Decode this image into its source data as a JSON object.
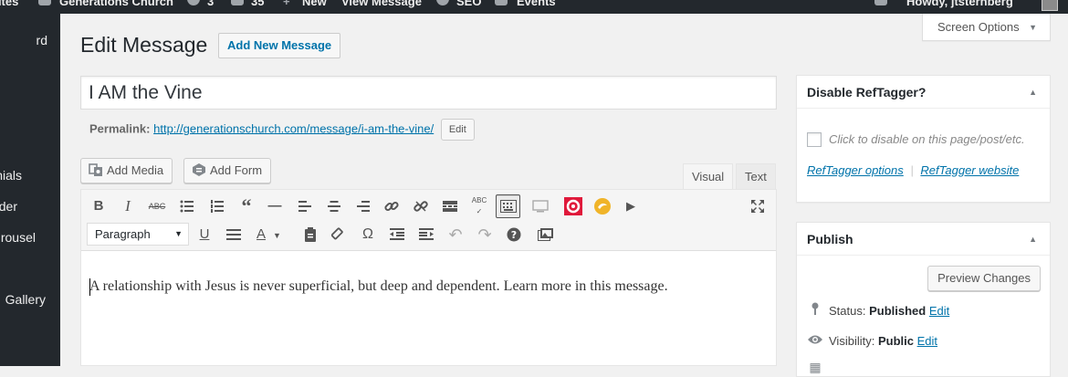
{
  "admin_bar": {
    "items": [
      "bites",
      "Generations Church",
      "3",
      "35",
      "New",
      "View Message",
      "SEO",
      "Events"
    ],
    "greeting": "Howdy, jtsternberg"
  },
  "admin_menu": {
    "items": [
      "rd",
      "nials",
      "der",
      "rousel",
      "Gallery"
    ]
  },
  "header": {
    "title": "Edit Message",
    "add_new_label": "Add New Message",
    "screen_options_label": "Screen Options"
  },
  "post": {
    "title": "I AM the Vine",
    "permalink_label": "Permalink:",
    "permalink_url": "http://generationschurch.com/message/i-am-the-vine/",
    "permalink_edit_label": "Edit"
  },
  "media_buttons": {
    "add_media": "Add Media",
    "add_form": "Add Form"
  },
  "editor": {
    "tab_visual": "Visual",
    "tab_text": "Text",
    "format_select_value": "Paragraph",
    "content": "A relationship with Jesus is never superficial, but deep and dependent. Learn more in this message."
  },
  "reftagger_box": {
    "title": "Disable RefTagger?",
    "checkbox_label": "Click to disable on this page/post/etc.",
    "options_link": "RefTagger options",
    "separator": "|",
    "website_link": "RefTagger website"
  },
  "publish_box": {
    "title": "Publish",
    "preview_label": "Preview Changes",
    "status_label": "Status:",
    "status_value": "Published",
    "visibility_label": "Visibility:",
    "visibility_value": "Public",
    "edit_label": "Edit"
  },
  "colors": {
    "admin_bar_bg": "#23282d",
    "link": "#0073aa",
    "background": "#f1f1f1"
  }
}
